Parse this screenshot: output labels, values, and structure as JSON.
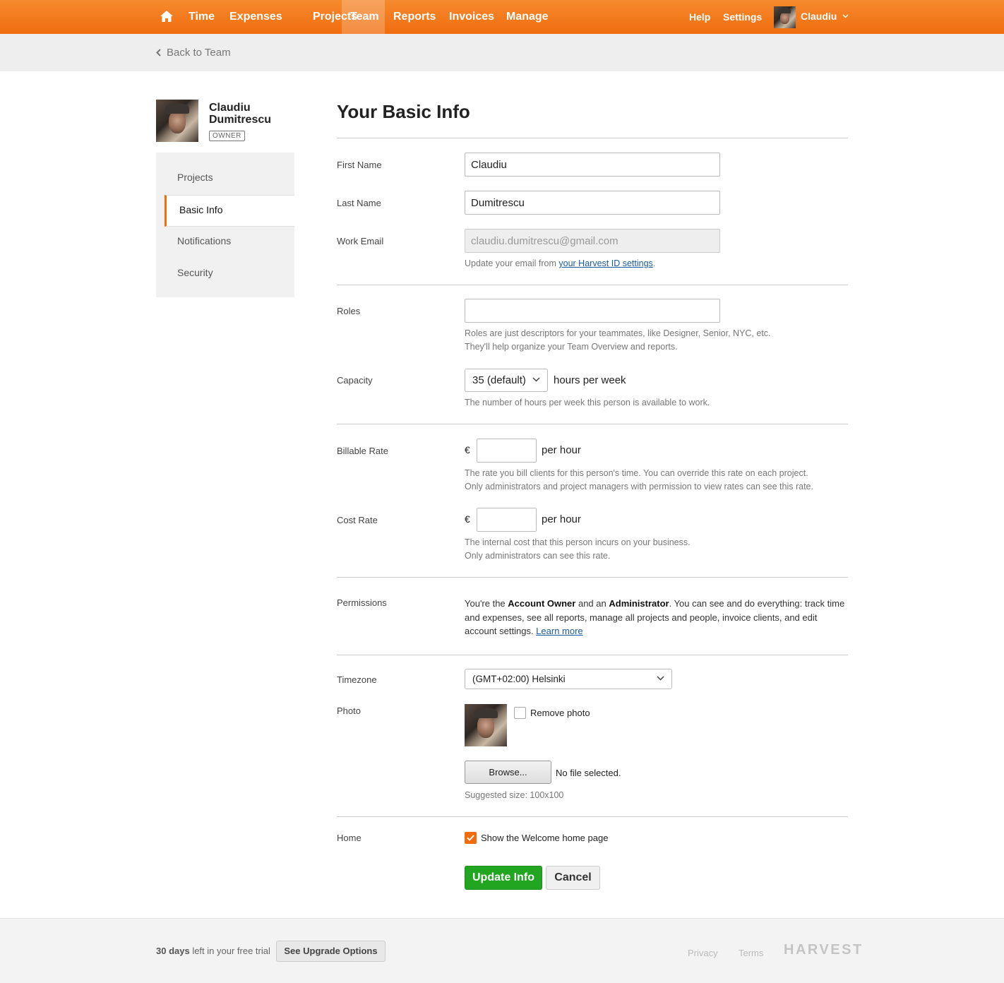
{
  "nav": {
    "items": [
      {
        "label": "Time",
        "active": false
      },
      {
        "label": "Expenses",
        "active": false
      },
      {
        "label": "Projects",
        "active": false
      },
      {
        "label": "Team",
        "active": true
      },
      {
        "label": "Reports",
        "active": false
      },
      {
        "label": "Invoices",
        "active": false
      },
      {
        "label": "Manage",
        "active": false
      }
    ],
    "help": "Help",
    "settings": "Settings",
    "user": "Claudiu",
    "brand_color": "#f36c0c"
  },
  "subbar": {
    "back_label": "Back to Team"
  },
  "sidebar": {
    "name_line1": "Claudiu",
    "name_line2": "Dumitrescu",
    "badge": "OWNER",
    "items": [
      {
        "label": "Projects"
      },
      {
        "label": "Basic Info",
        "active": true
      },
      {
        "label": "Notifications"
      },
      {
        "label": "Security"
      }
    ]
  },
  "form": {
    "title": "Your Basic Info",
    "first_name": {
      "label": "First Name",
      "value": "Claudiu"
    },
    "last_name": {
      "label": "Last Name",
      "value": "Dumitrescu"
    },
    "work_email": {
      "label": "Work Email",
      "value": "claudiu.dumitrescu@gmail.com",
      "hint_prefix": "Update your email from ",
      "hint_link": "your Harvest ID settings",
      "hint_suffix": "."
    },
    "roles": {
      "label": "Roles",
      "value": "",
      "hint_line1": "Roles are just descriptors for your teammates, like Designer, Senior, NYC, etc.",
      "hint_line2": "They'll help organize your Team Overview and reports."
    },
    "capacity": {
      "label": "Capacity",
      "value": "35 (default)",
      "suffix": "hours per week",
      "hint": "The number of hours per week this person is available to work."
    },
    "billable_rate": {
      "label": "Billable Rate",
      "currency": "€",
      "value": "",
      "suffix": "per hour",
      "hint_line1": "The rate you bill clients for this person's time. You can override this rate on each project.",
      "hint_line2": "Only administrators and project managers with permission to view rates can see this rate."
    },
    "cost_rate": {
      "label": "Cost Rate",
      "currency": "€",
      "value": "",
      "suffix": "per hour",
      "hint_line1": "The internal cost that this person incurs on your business.",
      "hint_line2": "Only administrators can see this rate."
    },
    "permissions": {
      "label": "Permissions",
      "text_1": "You're the ",
      "bold_1": "Account Owner",
      "text_2": " and an ",
      "bold_2": "Administrator",
      "text_3": ". You can see and do everything: track time and expenses, see all reports, manage all projects and people, invoice clients, and edit account settings. ",
      "link": "Learn more"
    },
    "timezone": {
      "label": "Timezone",
      "value": "(GMT+02:00) Helsinki"
    },
    "photo": {
      "label": "Photo",
      "remove_label": "Remove photo",
      "remove_checked": false,
      "browse_label": "Browse...",
      "file_status": "No file selected.",
      "suggested": "Suggested size: 100x100"
    },
    "home": {
      "label": "Home",
      "checkbox_label": "Show the Welcome home page",
      "checked": true
    },
    "submit_label": "Update Info",
    "cancel_label": "Cancel",
    "submit_color": "#22a622"
  },
  "footer": {
    "trial_days": "30 days",
    "trial_text": " left in your free trial",
    "upgrade_label": "See Upgrade Options",
    "privacy": "Privacy",
    "terms": "Terms",
    "brand": "HARVEST"
  }
}
